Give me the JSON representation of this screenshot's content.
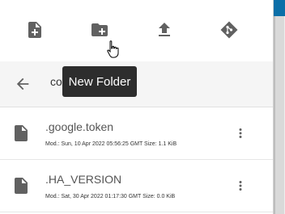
{
  "toolbar": {
    "buttons": [
      {
        "name": "new-file-button",
        "icon": "note-plus-icon"
      },
      {
        "name": "new-folder-button",
        "icon": "folder-plus-icon"
      },
      {
        "name": "upload-button",
        "icon": "upload-icon"
      },
      {
        "name": "git-button",
        "icon": "git-icon"
      }
    ]
  },
  "tooltip": {
    "text": "New Folder"
  },
  "path_bar": {
    "text": "co"
  },
  "files": [
    {
      "name": ".google.token",
      "meta": "Mod.: Sun, 10 Apr 2022 05:56:25 GMT  Size: 1.1 KiB"
    },
    {
      "name": ".HA_VERSION",
      "meta": "Mod.: Sat, 30 Apr 2022 01:17:30 GMT  Size: 0.0 KiB"
    }
  ],
  "colors": {
    "icon": "#616161",
    "tooltip_bg": "#2d2d2d",
    "accent_bar": "#0a6fa8"
  }
}
